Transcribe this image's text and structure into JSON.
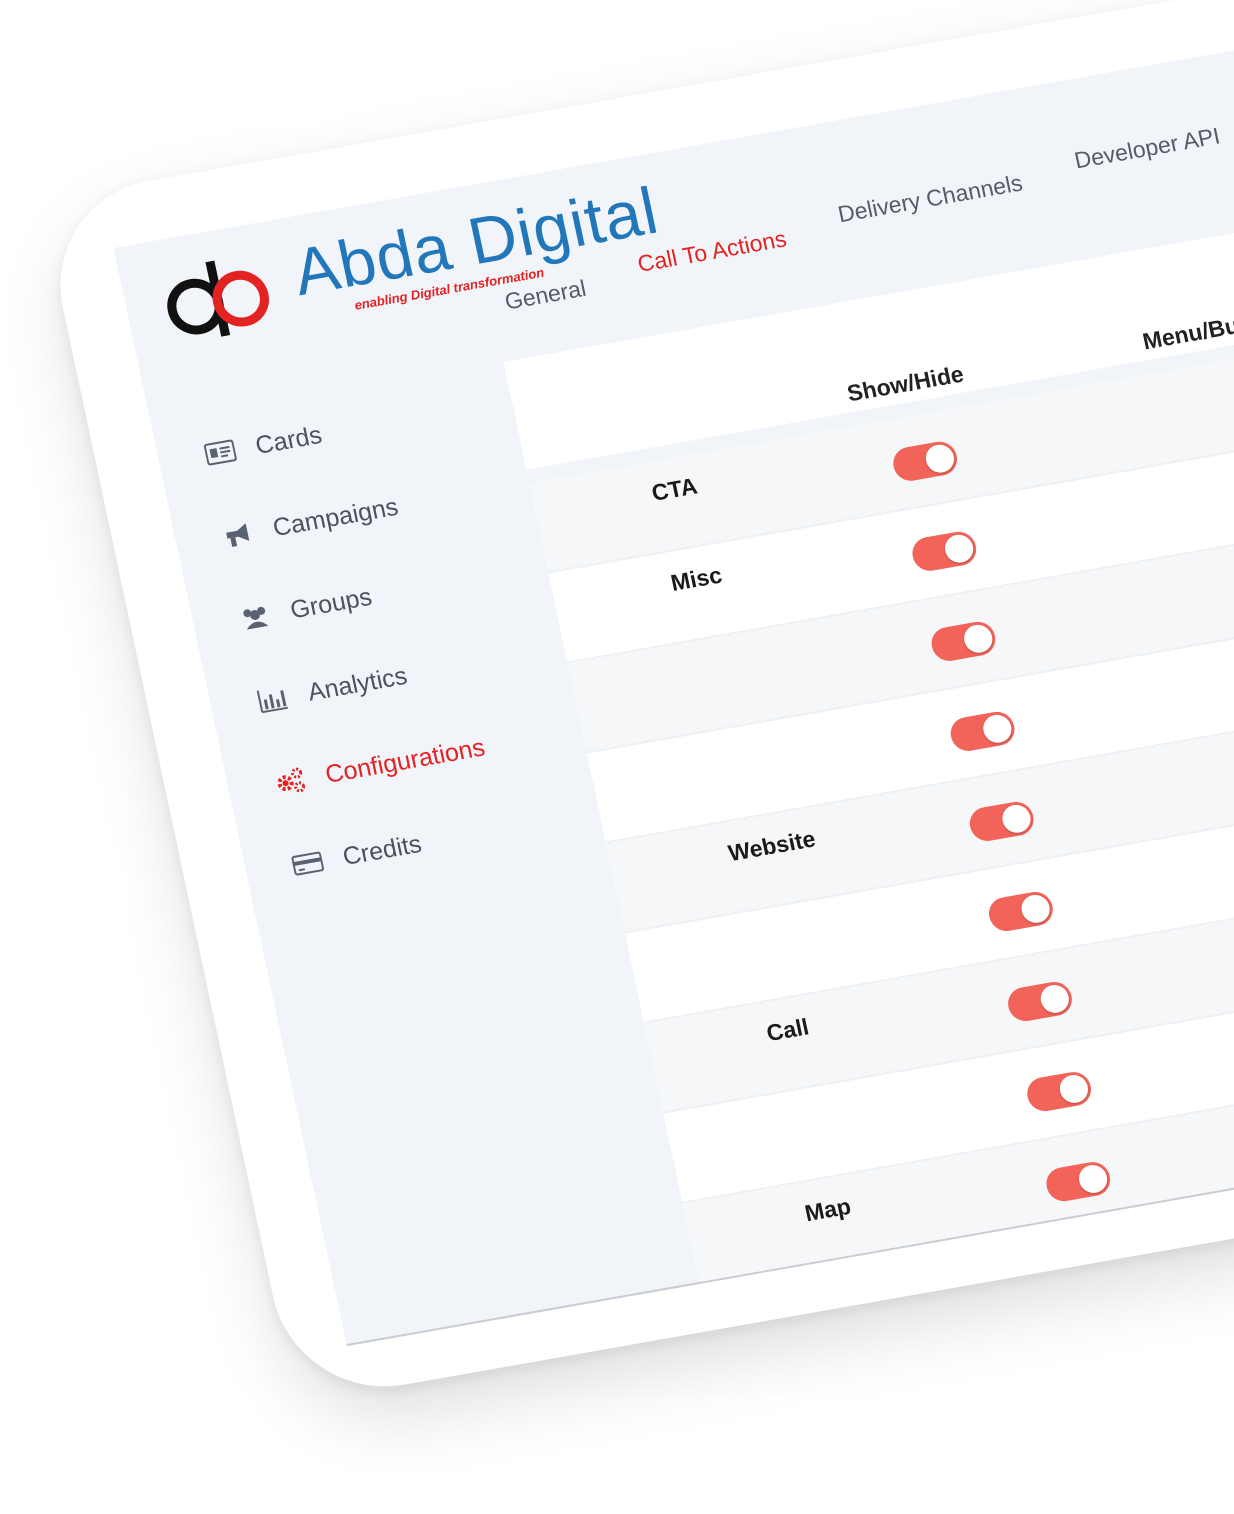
{
  "brand": {
    "name": "Abda Digital",
    "tagline": "enabling Digital transformation",
    "colors": {
      "blue": "#2277bb",
      "red": "#e32222",
      "toggle_on": "#f2645a"
    }
  },
  "tabs": [
    {
      "label": "General"
    },
    {
      "label": "Call To Actions"
    },
    {
      "label": "Delivery Channels"
    },
    {
      "label": "Developer API"
    }
  ],
  "active_tab": "Call To Actions",
  "sidebar": {
    "items": [
      {
        "label": "Cards",
        "icon": "id-card-icon"
      },
      {
        "label": "Campaigns",
        "icon": "megaphone-icon"
      },
      {
        "label": "Groups",
        "icon": "users-icon"
      },
      {
        "label": "Analytics",
        "icon": "bar-chart-icon"
      },
      {
        "label": "Configurations",
        "icon": "gears-icon"
      },
      {
        "label": "Credits",
        "icon": "credit-card-icon"
      }
    ],
    "active": "Configurations"
  },
  "table": {
    "columns": {
      "cta": "CTA",
      "show_hide": "Show/Hide",
      "menu_button": "Menu/Button"
    },
    "rows": [
      {
        "label": "Misc",
        "show": true
      },
      {
        "label": "",
        "show": true
      },
      {
        "label": "",
        "show": true
      },
      {
        "label": "",
        "show": true
      },
      {
        "label": "Website",
        "show": true
      },
      {
        "label": "",
        "show": true
      },
      {
        "label": "Call",
        "show": true
      },
      {
        "label": "",
        "show": true
      },
      {
        "label": "Map",
        "show": true
      }
    ]
  }
}
